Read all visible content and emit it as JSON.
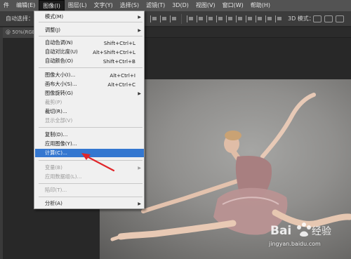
{
  "menubar": {
    "items": [
      "编辑(E)",
      "图像(I)",
      "图层(L)",
      "文字(Y)",
      "选择(S)",
      "滤镜(T)",
      "3D(D)",
      "视图(V)",
      "窗口(W)",
      "帮助(H)"
    ],
    "partial_left": "件"
  },
  "options_bar": {
    "auto_select_label": "自动选择：",
    "mode_3d_label": "3D 模式："
  },
  "document_tab": {
    "title": "@ 50%(RGB/8"
  },
  "image_menu": {
    "items": [
      {
        "label": "模式(M)",
        "shortcut": "",
        "submenu": true,
        "enabled": true
      },
      {
        "label": "调整(J)",
        "shortcut": "",
        "submenu": true,
        "enabled": true
      },
      {
        "label": "自动色调(N)",
        "shortcut": "Shift+Ctrl+L",
        "submenu": false,
        "enabled": true
      },
      {
        "label": "自动对比度(U)",
        "shortcut": "Alt+Shift+Ctrl+L",
        "submenu": false,
        "enabled": true
      },
      {
        "label": "自动颜色(O)",
        "shortcut": "Shift+Ctrl+B",
        "submenu": false,
        "enabled": true
      },
      {
        "label": "图像大小(I)...",
        "shortcut": "Alt+Ctrl+I",
        "submenu": false,
        "enabled": true
      },
      {
        "label": "画布大小(S)...",
        "shortcut": "Alt+Ctrl+C",
        "submenu": false,
        "enabled": true
      },
      {
        "label": "图像旋转(G)",
        "shortcut": "",
        "submenu": true,
        "enabled": true
      },
      {
        "label": "裁剪(P)",
        "shortcut": "",
        "submenu": false,
        "enabled": false
      },
      {
        "label": "裁切(R)...",
        "shortcut": "",
        "submenu": false,
        "enabled": true
      },
      {
        "label": "显示全部(V)",
        "shortcut": "",
        "submenu": false,
        "enabled": false
      },
      {
        "label": "复制(D)...",
        "shortcut": "",
        "submenu": false,
        "enabled": true
      },
      {
        "label": "应用图像(Y)...",
        "shortcut": "",
        "submenu": false,
        "enabled": true
      },
      {
        "label": "计算(C)...",
        "shortcut": "",
        "submenu": false,
        "enabled": true,
        "highlighted": true
      },
      {
        "label": "变量(B)",
        "shortcut": "",
        "submenu": true,
        "enabled": false
      },
      {
        "label": "应用数据组(L)...",
        "shortcut": "",
        "submenu": false,
        "enabled": false
      },
      {
        "label": "陷印(T)...",
        "shortcut": "",
        "submenu": false,
        "enabled": false
      },
      {
        "label": "分析(A)",
        "shortcut": "",
        "submenu": true,
        "enabled": true
      }
    ]
  },
  "watermark": {
    "brand_left": "Bai",
    "brand_right": "经验",
    "url": "jingyan.baidu.com"
  },
  "colors": {
    "menu_highlight": "#3477d0",
    "annotation_arrow": "#e0262a",
    "menubar_bg": "#535353",
    "workspace_bg": "#282828"
  }
}
